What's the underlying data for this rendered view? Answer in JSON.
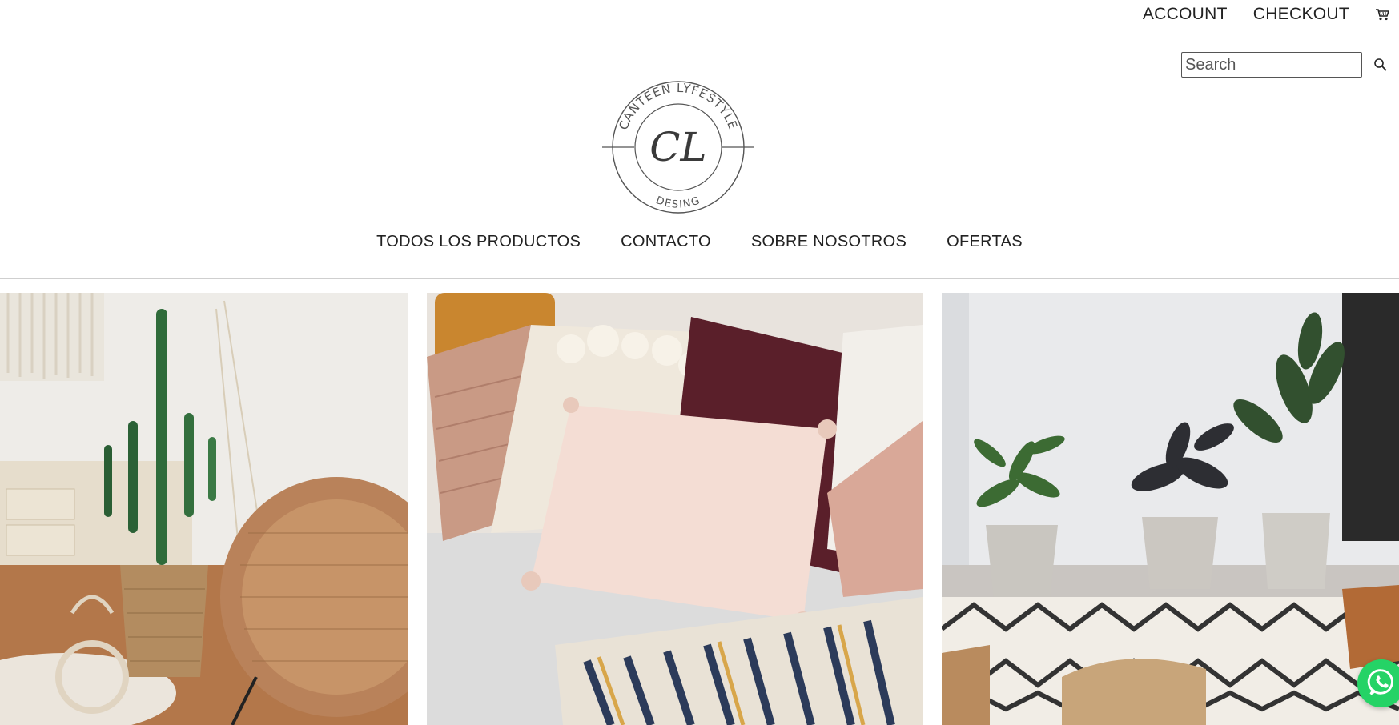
{
  "header": {
    "links": [
      {
        "label": "ACCOUNT"
      },
      {
        "label": "CHECKOUT"
      }
    ],
    "cart_icon": "shopping-cart-icon"
  },
  "search": {
    "placeholder": "Search",
    "value": "",
    "icon": "magnifier-icon"
  },
  "logo": {
    "top_text": "CANTEEN LYFESTYLE",
    "monogram": "CL",
    "bottom_text": "DESING"
  },
  "nav": {
    "items": [
      {
        "label": "TODOS LOS PRODUCTOS"
      },
      {
        "label": "CONTACTO"
      },
      {
        "label": "SOBRE NOSOTROS"
      },
      {
        "label": "OFERTAS"
      }
    ]
  },
  "gallery": {
    "tiles": [
      {
        "subject": "cactus-and-wicker-chair"
      },
      {
        "subject": "cushions-on-sofa"
      },
      {
        "subject": "plants-and-rug"
      }
    ]
  },
  "whatsapp": {
    "icon": "whatsapp-icon",
    "color": "#25d366"
  }
}
